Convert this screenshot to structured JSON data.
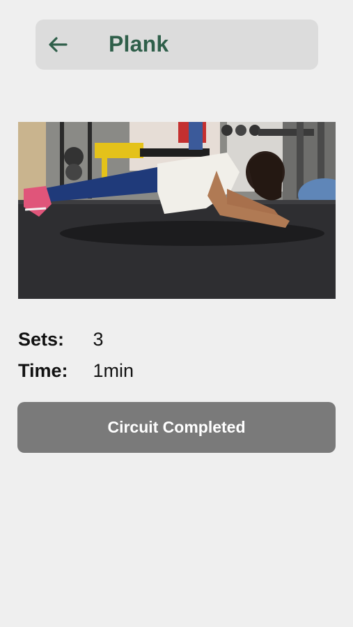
{
  "header": {
    "title": "Plank",
    "back_icon": "arrow-left-icon",
    "accent_color": "#2f5f4a"
  },
  "exercise": {
    "image_subject": "person-in-plank-position-photo",
    "sets_label": "Sets:",
    "sets_value": "3",
    "time_label": "Time:",
    "time_value": "1min"
  },
  "actions": {
    "complete_label": "Circuit Completed",
    "complete_color": "#7a7a7a"
  }
}
